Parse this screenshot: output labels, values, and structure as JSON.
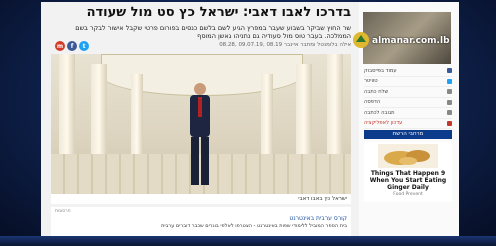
{
  "article": {
    "headline": "בדרכו לאבו דאבי: ישראל כץ סט מול שעודה",
    "subline": "שר החוץ שביקר בשבוע שעבר במפרץ הגיע לשם בלשם כנסים בפורום פרטי שקבל אישור לבקר בשם הממלכה. בעבר טוס מול סעודיה גם נתניהו גאשן המוסף",
    "meta": "אילה בלומנטל ומתבר איינבר  08.19 ,09.07.19  ,08.28",
    "caption": "ישראל כץ באבו דאבי",
    "share_labels": [
      "f",
      "t",
      "m"
    ]
  },
  "bottom_ad": {
    "tag": "פרסומת",
    "title": "קורס ערבית באינטרנט",
    "desc": "בית הספר המוביל ללימודי שפות באינטרנט - הצטרפו לאלפי בוגרים שכבר דוברים ערבית"
  },
  "sidebar": {
    "logo": "almanar.com.lb",
    "items": [
      {
        "label": "עמוד בפייסבוק",
        "red": false
      },
      {
        "label": "טוויטר",
        "red": false
      },
      {
        "label": "שלח כתבה",
        "red": false
      },
      {
        "label": "הדפסה",
        "red": false
      },
      {
        "label": "תגובה לכתבה",
        "red": false
      },
      {
        "label": "עדכון לאפליקציה",
        "red": true
      }
    ],
    "section_header": "מרחבי הרשת",
    "ad_title": "Things That Happen 9 When You Start Eating Ginger Daily",
    "ad_source": "Food Prevent"
  },
  "colors": {
    "accent": "#0d3b8c",
    "share_fb": "#3b5998",
    "share_tw": "#1da1f2",
    "share_mail": "#d23b2a"
  }
}
